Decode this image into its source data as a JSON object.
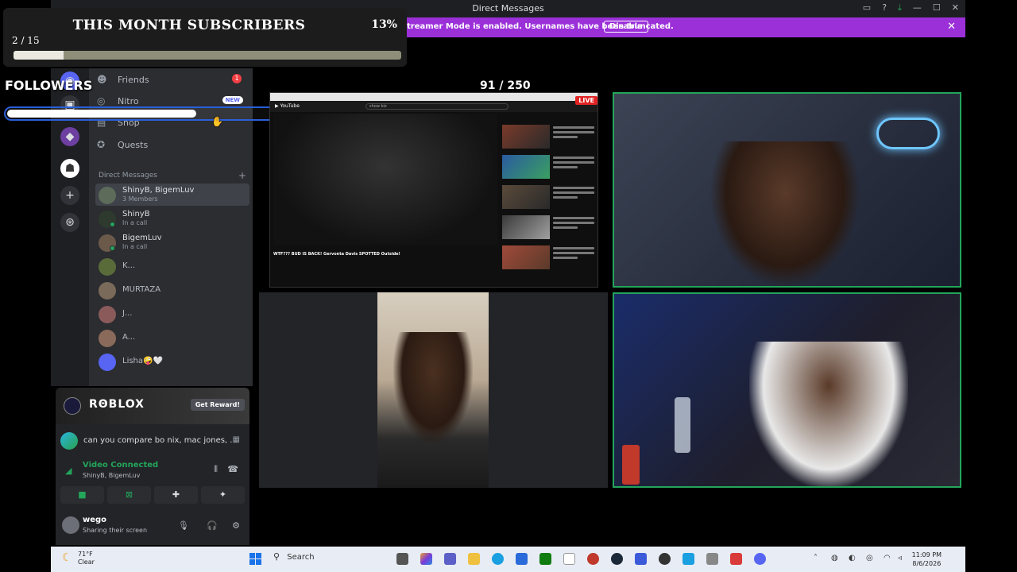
{
  "window": {
    "title": "Direct Messages"
  },
  "streamer_mode": {
    "message": "treamer Mode is enabled. Usernames have been truncated.",
    "button": "Disable",
    "close": "✕"
  },
  "overlay": {
    "subscribers_title": "THIS MONTH SUBSCRIBERS",
    "subscribers_percent": "13%",
    "subscribers_count": "2 / 15",
    "subscribers_progress": 0.13,
    "followers_label": "FOLLOWERS",
    "followers_count": "91 / 250",
    "followers_progress": 0.364
  },
  "sidebar": {
    "nav": [
      {
        "label": "Friends",
        "icon": "friends-icon",
        "badge": "1"
      },
      {
        "label": "Nitro",
        "icon": "nitro-icon",
        "badge": "NEW"
      },
      {
        "label": "Shop",
        "icon": "shop-icon"
      },
      {
        "label": "Quests",
        "icon": "quests-icon"
      }
    ],
    "dm_header": "Direct Messages",
    "dms": [
      {
        "name": "ShinyB, BigemLuv",
        "sub": "3 Members",
        "active": true,
        "color": "#5c6b5a"
      },
      {
        "name": "ShinyB",
        "sub": "In a call",
        "color": "#2f3a2e"
      },
      {
        "name": "BigemLuv",
        "sub": "In a call",
        "color": "#6b5a4a"
      },
      {
        "name": "K...",
        "sub": "",
        "color": "#5a6b3a"
      },
      {
        "name": "MURTAZA",
        "sub": "",
        "color": "#7a6a5a"
      },
      {
        "name": "J...",
        "sub": "",
        "color": "#8a5a5a"
      },
      {
        "name": "A...",
        "sub": "",
        "color": "#8a6a5a"
      },
      {
        "name": "Lisha🤪🤍",
        "sub": "",
        "color": "#5865f2"
      }
    ]
  },
  "promo": {
    "brand": "RΘBLOX",
    "button": "Get Reward!"
  },
  "activity": {
    "text": "can you compare bo nix, mac jones, ..."
  },
  "voice": {
    "status": "Video Connected",
    "channel": "ShinyB, BigemLuv"
  },
  "user": {
    "name": "wego",
    "status": "Sharing their screen"
  },
  "screen_share": {
    "live": "LIVE",
    "yt_logo": "▶ YouTube",
    "yt_search": "show biz",
    "video_title": "WTF??? BUD IS BACK! Gervonta Davis SPOTTED Outside!"
  },
  "taskbar": {
    "temp": "71°F",
    "weather": "Clear",
    "search": "Search",
    "time": "11:09 PM",
    "date": "8/6/2026"
  }
}
